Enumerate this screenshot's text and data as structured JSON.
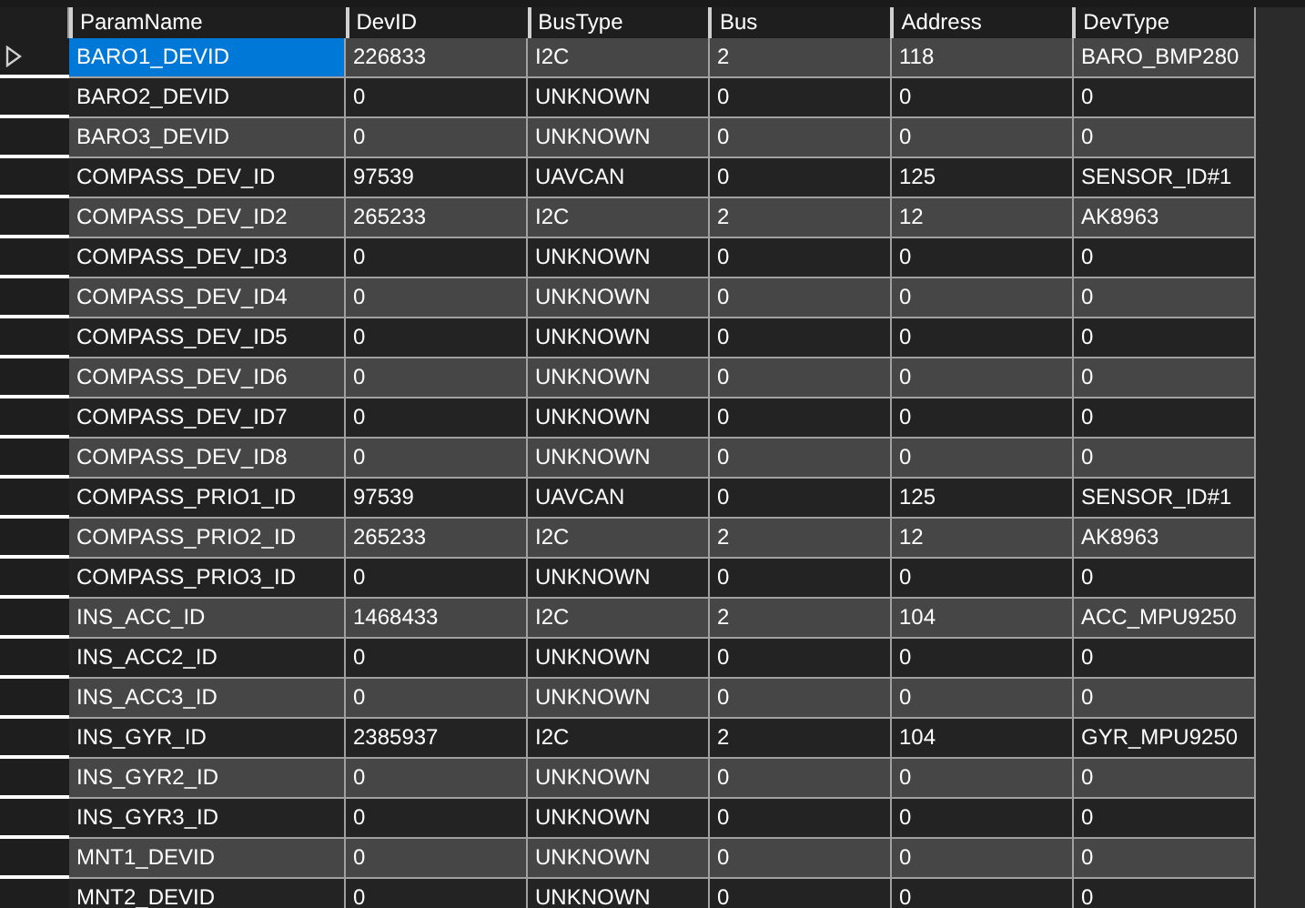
{
  "table": {
    "columns": [
      "ParamName",
      "DevID",
      "BusType",
      "Bus",
      "Address",
      "DevType"
    ],
    "rows": [
      {
        "selected": true,
        "cells": [
          "BARO1_DEVID",
          "226833",
          "I2C",
          "2",
          "118",
          "BARO_BMP280"
        ]
      },
      {
        "selected": false,
        "cells": [
          "BARO2_DEVID",
          "0",
          "UNKNOWN",
          "0",
          "0",
          "0"
        ]
      },
      {
        "selected": false,
        "cells": [
          "BARO3_DEVID",
          "0",
          "UNKNOWN",
          "0",
          "0",
          "0"
        ]
      },
      {
        "selected": false,
        "cells": [
          "COMPASS_DEV_ID",
          "97539",
          "UAVCAN",
          "0",
          "125",
          "SENSOR_ID#1"
        ]
      },
      {
        "selected": false,
        "cells": [
          "COMPASS_DEV_ID2",
          "265233",
          "I2C",
          "2",
          "12",
          "AK8963"
        ]
      },
      {
        "selected": false,
        "cells": [
          "COMPASS_DEV_ID3",
          "0",
          "UNKNOWN",
          "0",
          "0",
          "0"
        ]
      },
      {
        "selected": false,
        "cells": [
          "COMPASS_DEV_ID4",
          "0",
          "UNKNOWN",
          "0",
          "0",
          "0"
        ]
      },
      {
        "selected": false,
        "cells": [
          "COMPASS_DEV_ID5",
          "0",
          "UNKNOWN",
          "0",
          "0",
          "0"
        ]
      },
      {
        "selected": false,
        "cells": [
          "COMPASS_DEV_ID6",
          "0",
          "UNKNOWN",
          "0",
          "0",
          "0"
        ]
      },
      {
        "selected": false,
        "cells": [
          "COMPASS_DEV_ID7",
          "0",
          "UNKNOWN",
          "0",
          "0",
          "0"
        ]
      },
      {
        "selected": false,
        "cells": [
          "COMPASS_DEV_ID8",
          "0",
          "UNKNOWN",
          "0",
          "0",
          "0"
        ]
      },
      {
        "selected": false,
        "cells": [
          "COMPASS_PRIO1_ID",
          "97539",
          "UAVCAN",
          "0",
          "125",
          "SENSOR_ID#1"
        ]
      },
      {
        "selected": false,
        "cells": [
          "COMPASS_PRIO2_ID",
          "265233",
          "I2C",
          "2",
          "12",
          "AK8963"
        ]
      },
      {
        "selected": false,
        "cells": [
          "COMPASS_PRIO3_ID",
          "0",
          "UNKNOWN",
          "0",
          "0",
          "0"
        ]
      },
      {
        "selected": false,
        "cells": [
          "INS_ACC_ID",
          "1468433",
          "I2C",
          "2",
          "104",
          "ACC_MPU9250"
        ]
      },
      {
        "selected": false,
        "cells": [
          "INS_ACC2_ID",
          "0",
          "UNKNOWN",
          "0",
          "0",
          "0"
        ]
      },
      {
        "selected": false,
        "cells": [
          "INS_ACC3_ID",
          "0",
          "UNKNOWN",
          "0",
          "0",
          "0"
        ]
      },
      {
        "selected": false,
        "cells": [
          "INS_GYR_ID",
          "2385937",
          "I2C",
          "2",
          "104",
          "GYR_MPU9250"
        ]
      },
      {
        "selected": false,
        "cells": [
          "INS_GYR2_ID",
          "0",
          "UNKNOWN",
          "0",
          "0",
          "0"
        ]
      },
      {
        "selected": false,
        "cells": [
          "INS_GYR3_ID",
          "0",
          "UNKNOWN",
          "0",
          "0",
          "0"
        ]
      },
      {
        "selected": false,
        "cells": [
          "MNT1_DEVID",
          "0",
          "UNKNOWN",
          "0",
          "0",
          "0"
        ]
      },
      {
        "selected": false,
        "cells": [
          "MNT2_DEVID",
          "0",
          "UNKNOWN",
          "0",
          "0",
          "0"
        ]
      }
    ]
  }
}
